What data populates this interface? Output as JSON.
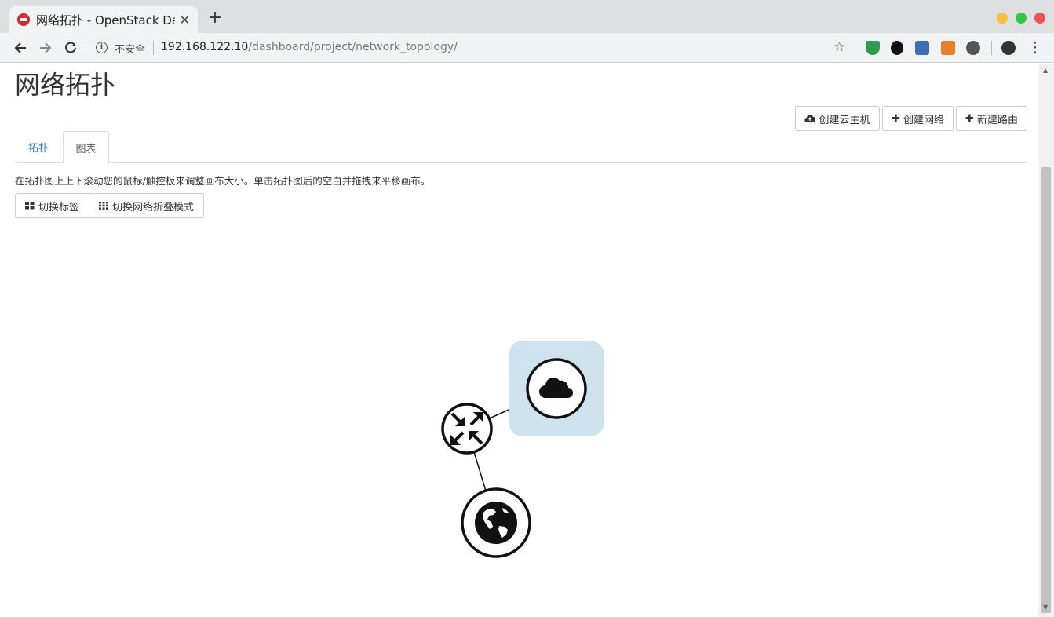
{
  "browser": {
    "tab_title": "网络拓扑 - OpenStack Da",
    "tab_close": "✕",
    "new_tab": "+",
    "security_label": "不安全",
    "url_host": "192.168.122.10",
    "url_path": "/dashboard/project/network_topology/",
    "icons": [
      "back-icon",
      "forward-icon",
      "reload-icon",
      "info-icon",
      "star-icon",
      "account-icon",
      "menu-icon"
    ]
  },
  "page": {
    "title": "网络拓扑",
    "actions": {
      "create_instance": "创建云主机",
      "create_network": "创建网络",
      "create_router": "新建路由"
    },
    "tabs": [
      {
        "label": "拓扑",
        "active": false
      },
      {
        "label": "图表",
        "active": true
      }
    ],
    "help_text": "在拓扑图上上下滚动您的鼠标/触控板来调整画布大小。单击拓扑图后的空白并拖拽来平移画布。",
    "toggle_labels": "切换标签",
    "toggle_collapse": "切换网络折叠模式"
  },
  "topology": {
    "nodes": [
      {
        "type": "network",
        "icon": "cloud-icon",
        "highlight": "#cfe3ef"
      },
      {
        "type": "router",
        "icon": "router-icon"
      },
      {
        "type": "external-network",
        "icon": "globe-icon"
      }
    ],
    "links": [
      [
        "router",
        "network"
      ],
      [
        "router",
        "external-network"
      ]
    ]
  }
}
